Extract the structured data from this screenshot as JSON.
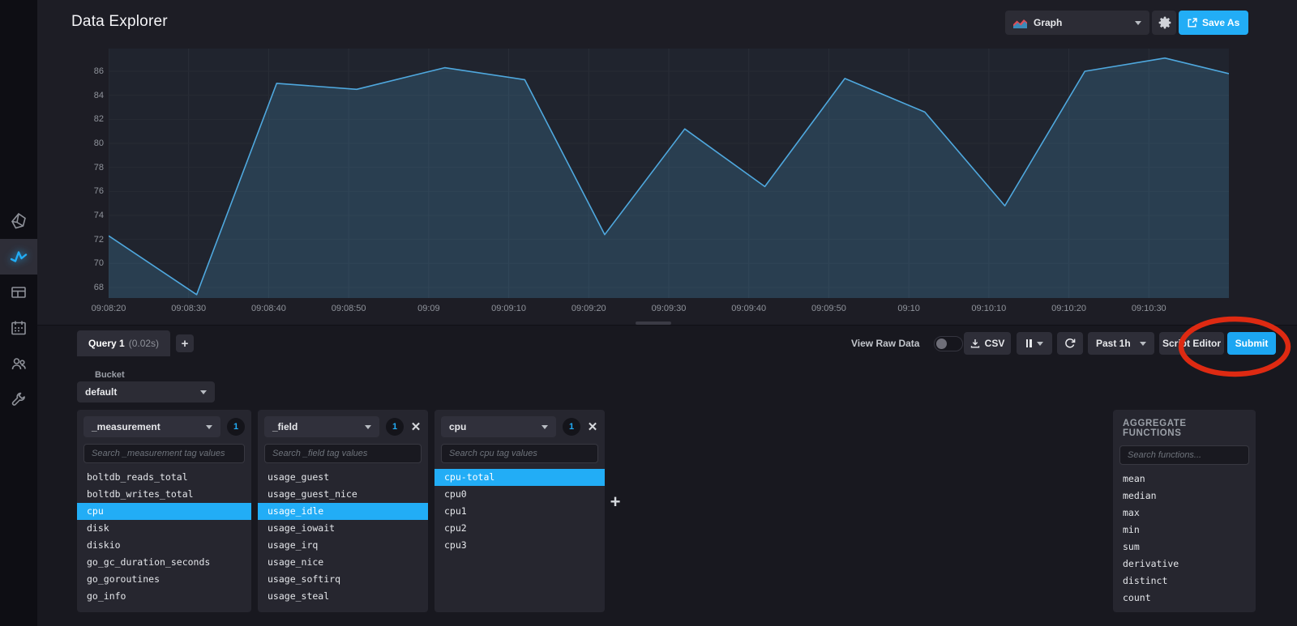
{
  "header": {
    "title": "Data Explorer",
    "viz_type": "Graph",
    "save_as_label": "Save As"
  },
  "sidebar": {
    "items": [
      "influxdb-logo",
      "data-explorer",
      "dashboards",
      "tasks",
      "organizations",
      "settings"
    ],
    "active": "data-explorer"
  },
  "chart_data": {
    "type": "area",
    "title": "",
    "xlabel": "",
    "ylabel": "",
    "grid": true,
    "legend": false,
    "x_range_seconds": [
      0,
      140
    ],
    "y_range": [
      67.12,
      87.89
    ],
    "y_ticks": [
      68,
      70,
      72,
      74,
      76,
      78,
      80,
      82,
      84,
      86
    ],
    "x_ticks": [
      {
        "sec": 0,
        "label": "09:08:20"
      },
      {
        "sec": 10,
        "label": "09:08:30"
      },
      {
        "sec": 20,
        "label": "09:08:40"
      },
      {
        "sec": 30,
        "label": "09:08:50"
      },
      {
        "sec": 40,
        "label": "09:09"
      },
      {
        "sec": 50,
        "label": "09:09:10"
      },
      {
        "sec": 60,
        "label": "09:09:20"
      },
      {
        "sec": 70,
        "label": "09:09:30"
      },
      {
        "sec": 80,
        "label": "09:09:40"
      },
      {
        "sec": 90,
        "label": "09:09:50"
      },
      {
        "sec": 100,
        "label": "09:10"
      },
      {
        "sec": 110,
        "label": "09:10:10"
      },
      {
        "sec": 120,
        "label": "09:10:20"
      },
      {
        "sec": 130,
        "label": "09:10:30"
      }
    ],
    "series": [
      {
        "name": "usage_idle",
        "x_seconds": [
          0,
          11,
          21,
          31,
          42,
          52,
          62,
          72,
          82,
          92,
          102,
          112,
          122,
          132,
          140
        ],
        "values": [
          72.3,
          67.4,
          85.0,
          84.5,
          86.3,
          85.3,
          72.4,
          81.2,
          76.4,
          85.4,
          82.6,
          74.8,
          86.0,
          87.1,
          85.8
        ]
      }
    ]
  },
  "toolbar": {
    "tab_name": "Query 1",
    "tab_duration": "(0.02s)",
    "add_tab": "+",
    "view_raw_data": "View Raw Data",
    "csv": "CSV",
    "range": "Past 1h",
    "script_editor": "Script Editor",
    "submit": "Submit"
  },
  "builder": {
    "bucket_label": "Bucket",
    "bucket_value": "default",
    "add_card": "+",
    "cards": [
      {
        "key": "_measurement",
        "count": "1",
        "closable": false,
        "search_placeholder": "Search _measurement tag values",
        "items": [
          "boltdb_reads_total",
          "boltdb_writes_total",
          "cpu",
          "disk",
          "diskio",
          "go_gc_duration_seconds",
          "go_goroutines",
          "go_info"
        ],
        "selected": [
          "cpu"
        ]
      },
      {
        "key": "_field",
        "count": "1",
        "closable": true,
        "search_placeholder": "Search _field tag values",
        "items": [
          "usage_guest",
          "usage_guest_nice",
          "usage_idle",
          "usage_iowait",
          "usage_irq",
          "usage_nice",
          "usage_softirq",
          "usage_steal"
        ],
        "selected": [
          "usage_idle"
        ]
      },
      {
        "key": "cpu",
        "count": "1",
        "closable": true,
        "search_placeholder": "Search cpu tag values",
        "items": [
          "cpu-total",
          "cpu0",
          "cpu1",
          "cpu2",
          "cpu3"
        ],
        "selected": [
          "cpu-total"
        ]
      }
    ],
    "aggregate": {
      "title": "AGGREGATE FUNCTIONS",
      "search_placeholder": "Search functions...",
      "items": [
        "mean",
        "median",
        "max",
        "min",
        "sum",
        "derivative",
        "distinct",
        "count"
      ]
    }
  },
  "colors": {
    "accent": "#22ADF6",
    "line": "#4FA8DE",
    "plot_bg": "#20242E",
    "annotation_red": "#DE2A12"
  }
}
